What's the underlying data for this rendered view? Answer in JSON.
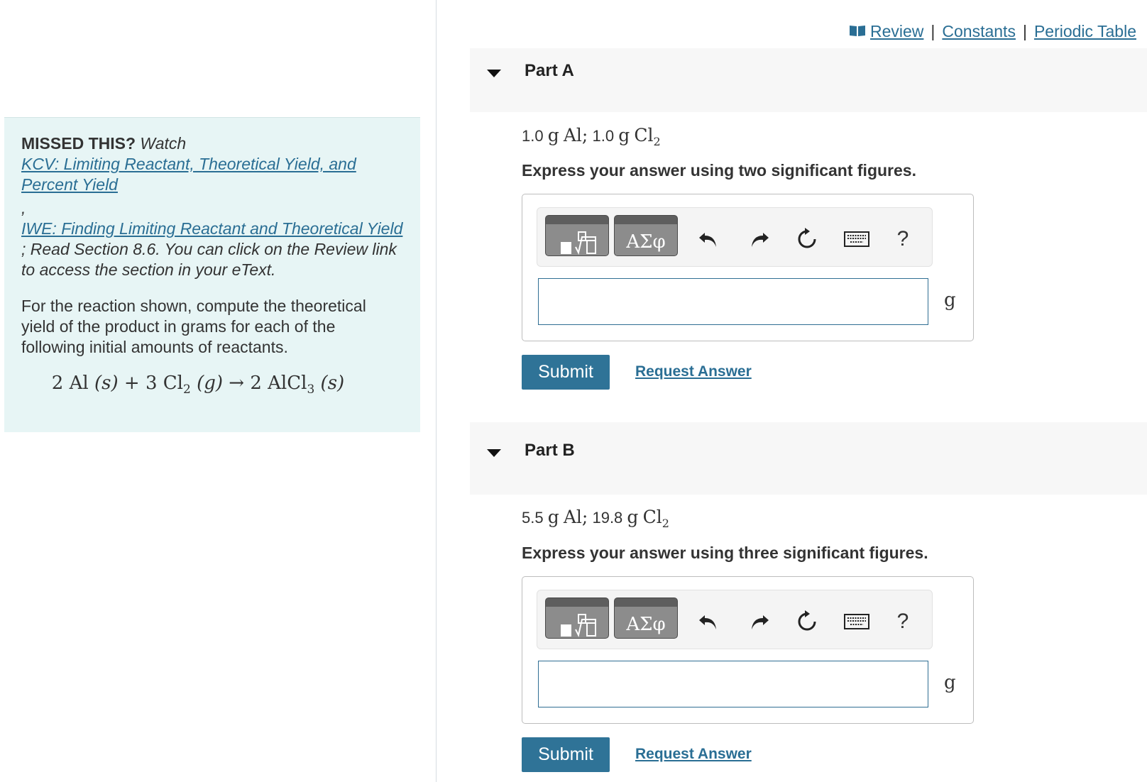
{
  "header_links": {
    "review": "Review",
    "separator": "|",
    "constants": "Constants",
    "periodic_table": "Periodic Table",
    "icon": "book-icon"
  },
  "left_panel": {
    "missed_label": "MISSED THIS?",
    "watch": "Watch",
    "link1": "KCV: Limiting Reactant, Theoretical Yield, and Percent Yield",
    "comma": ",",
    "link2": "IWE: Finding Limiting Reactant and Theoretical Yield",
    "read_text": "; Read Section 8.6. You can click on the Review link to access the section in your eText.",
    "prompt": "For the reaction shown, compute the theoretical yield of the product in grams for each of the following initial amounts of reactants.",
    "equation": {
      "a_coef": "2",
      "a": "Al",
      "a_state": "(s)",
      "plus": "+",
      "b_coef": "3",
      "b": "Cl",
      "b_sub": "2",
      "b_state": "(g)",
      "arrow": "→",
      "c_coef": "2",
      "c": "AlCl",
      "c_sub": "3",
      "c_state": "(s)"
    }
  },
  "parts": [
    {
      "title": "Part A",
      "reactant1_amount": "1.0",
      "reactant1_unit": "g",
      "reactant1": "Al;",
      "reactant2_amount": "1.0",
      "reactant2_unit": "g",
      "reactant2": "Cl",
      "reactant2_sub": "2",
      "instruction": "Express your answer using two significant figures.",
      "answer_value": "",
      "unit": "g",
      "submit": "Submit",
      "request": "Request Answer"
    },
    {
      "title": "Part B",
      "reactant1_amount": "5.5",
      "reactant1_unit": "g",
      "reactant1": "Al;",
      "reactant2_amount": "19.8",
      "reactant2_unit": "g",
      "reactant2": "Cl",
      "reactant2_sub": "2",
      "instruction": "Express your answer using three significant figures.",
      "answer_value": "",
      "unit": "g",
      "submit": "Submit",
      "request": "Request Answer"
    }
  ],
  "toolbar": {
    "greek_label": "ΑΣφ",
    "help_label": "?",
    "icons": [
      "templates-icon",
      "greek-letters-icon",
      "undo-icon",
      "redo-icon",
      "reset-icon",
      "keyboard-icon",
      "help-icon"
    ]
  },
  "colors": {
    "accent": "#2f7397",
    "link": "#2a6e94",
    "panel_bg": "#e7f5f5",
    "part_header_bg": "#f7f7f7"
  }
}
